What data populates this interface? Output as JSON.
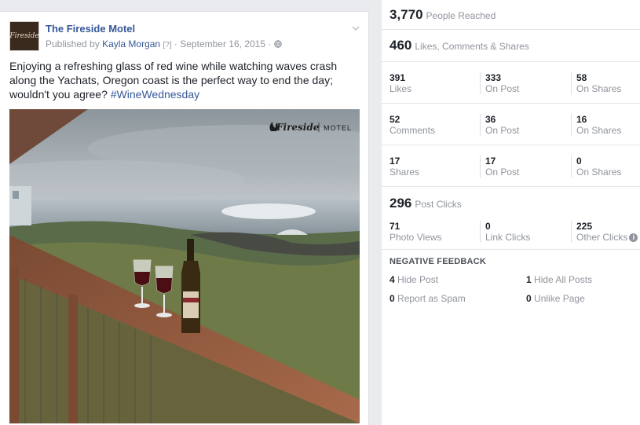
{
  "post": {
    "page_name": "The Fireside Motel",
    "published_by_prefix": "Published by",
    "author": "Kayla Morgan",
    "help_marker": "[?]",
    "date": "· September 16, 2015 ·",
    "caption_text": "Enjoying a refreshing glass of red wine while watching waves crash along the Yachats, Oregon coast is the perfect way to end the day; wouldn't you agree? ",
    "hashtag": "#WineWednesday",
    "avatar_text": "Fireside",
    "photo_watermark_brand": "Fireside",
    "photo_watermark_sub": "MOTEL"
  },
  "insights": {
    "reach": {
      "value": "3,770",
      "label": "People Reached"
    },
    "engagement": {
      "value": "460",
      "label": "Likes, Comments & Shares"
    },
    "grid": [
      [
        {
          "n": "391",
          "l": "Likes"
        },
        {
          "n": "333",
          "l": "On Post"
        },
        {
          "n": "58",
          "l": "On Shares"
        }
      ],
      [
        {
          "n": "52",
          "l": "Comments"
        },
        {
          "n": "36",
          "l": "On Post"
        },
        {
          "n": "16",
          "l": "On Shares"
        }
      ],
      [
        {
          "n": "17",
          "l": "Shares"
        },
        {
          "n": "17",
          "l": "On Post"
        },
        {
          "n": "0",
          "l": "On Shares"
        }
      ]
    ],
    "clicks": {
      "value": "296",
      "label": "Post Clicks"
    },
    "click_grid": [
      {
        "n": "71",
        "l": "Photo Views"
      },
      {
        "n": "0",
        "l": "Link Clicks"
      },
      {
        "n": "225",
        "l": "Other Clicks"
      }
    ],
    "negative": {
      "title": "NEGATIVE FEEDBACK",
      "items": [
        {
          "n": "4",
          "l": "Hide Post"
        },
        {
          "n": "1",
          "l": "Hide All Posts"
        },
        {
          "n": "0",
          "l": "Report as Spam"
        },
        {
          "n": "0",
          "l": "Unlike Page"
        }
      ]
    }
  },
  "icons": [
    "globe-icon",
    "chevron-down-icon",
    "info-icon"
  ],
  "colors": {
    "link": "#365899",
    "muted": "#90949c",
    "text": "#1d2129"
  }
}
